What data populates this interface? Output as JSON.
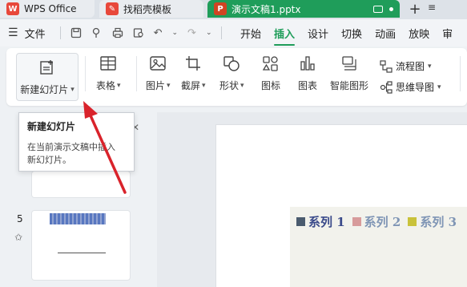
{
  "titlebar": {
    "tabs": [
      {
        "label": "WPS Office"
      },
      {
        "label": "找稻壳模板"
      },
      {
        "label": "演示文稿1.pptx"
      }
    ],
    "add_symbol": "+",
    "menu_symbol": "≡"
  },
  "menubar": {
    "file_label": "文件",
    "items": [
      "开始",
      "插入",
      "设计",
      "切换",
      "动画",
      "放映",
      "审"
    ],
    "active_item": "插入"
  },
  "ribbon": {
    "new_slide_label": "新建幻灯片",
    "table_label": "表格",
    "picture_label": "图片",
    "screenshot_label": "截屏",
    "shape_label": "形状",
    "icon_label": "图标",
    "chart_label": "图表",
    "smartart_label": "智能图形",
    "flowchart_label": "流程图",
    "mindmap_label": "思维导图"
  },
  "tooltip": {
    "title": "新建幻灯片",
    "body_line1": "在当前演示文稿中插入",
    "body_line2": "新幻灯片。"
  },
  "panel": {
    "slide_number": "5"
  },
  "legend": [
    {
      "label": "系列 1",
      "color": "#4a5b6e"
    },
    {
      "label": "系列 2",
      "color": "#d79b9b"
    },
    {
      "label": "系列 3",
      "color": "#c9c23a"
    }
  ],
  "colors": {
    "accent": "#1f9d5a",
    "doc_tab": "#1f9d5a",
    "arrow": "#d9232b"
  }
}
